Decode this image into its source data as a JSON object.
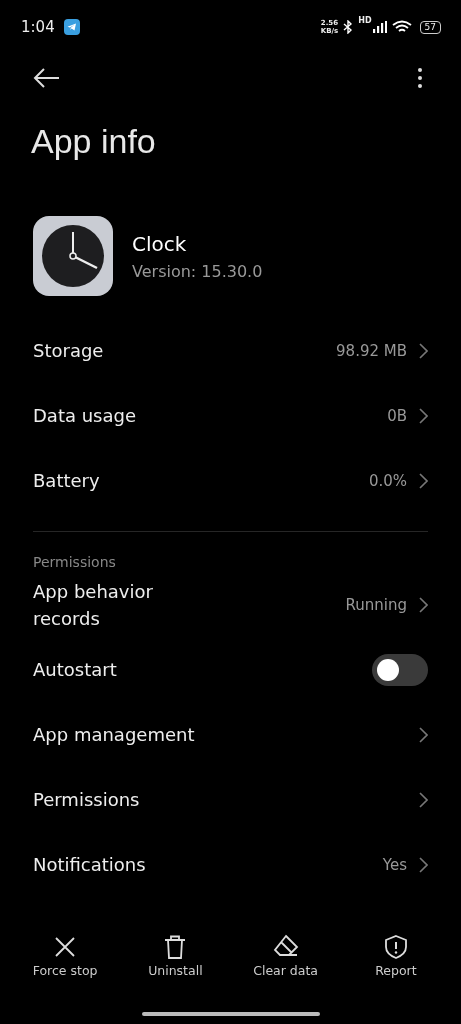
{
  "status_bar": {
    "time": "1:04",
    "speed": "2.56",
    "speed_unit": "KB/s",
    "network": "HD",
    "battery": "57"
  },
  "title": "App info",
  "app": {
    "name": "Clock",
    "version": "Version: 15.30.0"
  },
  "sections": [
    {
      "items": [
        {
          "kind": "link",
          "label": "Storage",
          "value": "98.92 MB"
        },
        {
          "kind": "link",
          "label": "Data usage",
          "value": "0B"
        },
        {
          "kind": "link",
          "label": "Battery",
          "value": "0.0%"
        }
      ]
    },
    {
      "header": "Permissions",
      "items": [
        {
          "kind": "link",
          "label": "App behavior records",
          "value": "Running"
        },
        {
          "kind": "toggle",
          "label": "Autostart",
          "on": false
        },
        {
          "kind": "link",
          "label": "App management"
        },
        {
          "kind": "link",
          "label": "Permissions"
        },
        {
          "kind": "link",
          "label": "Notifications",
          "value": "Yes"
        }
      ]
    }
  ],
  "actions": [
    {
      "kind": "stop",
      "label": "Force stop"
    },
    {
      "kind": "uninstall",
      "label": "Uninstall"
    },
    {
      "kind": "clear",
      "label": "Clear data"
    },
    {
      "kind": "report",
      "label": "Report"
    }
  ]
}
